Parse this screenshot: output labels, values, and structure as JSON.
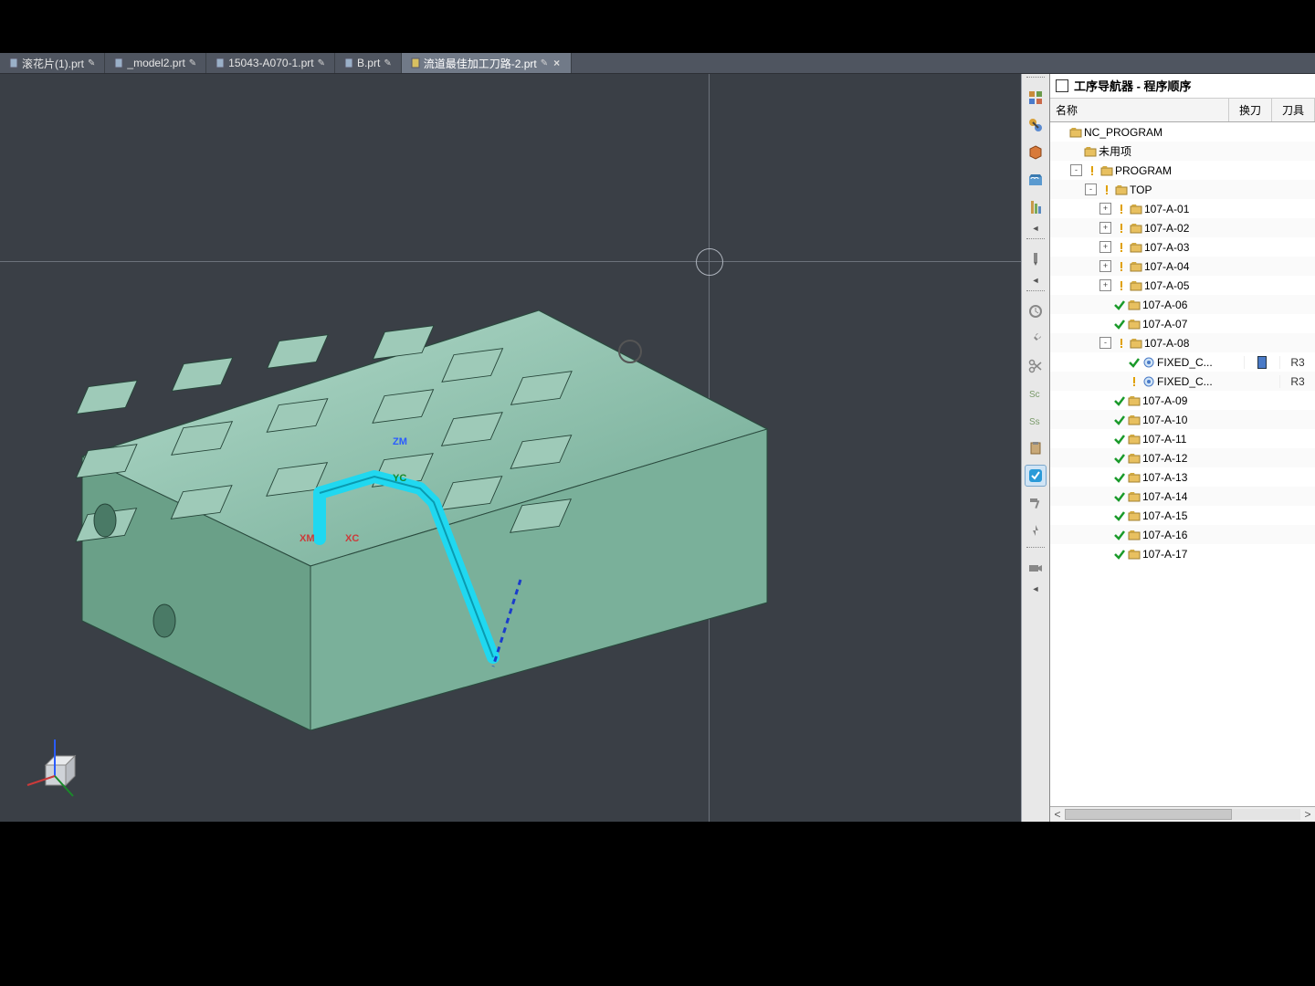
{
  "tabs": [
    {
      "label": "滚花片(1).prt",
      "mod": "✎"
    },
    {
      "label": "_model2.prt",
      "mod": "✎"
    },
    {
      "label": "15043-A070-1.prt",
      "mod": "✎"
    },
    {
      "label": "B.prt",
      "mod": "✎"
    },
    {
      "label": "流道最佳加工刀路-2.prt",
      "mod": "✎",
      "active": true,
      "close": true
    }
  ],
  "panel": {
    "title": "工序导航器 - 程序顺序",
    "columns": {
      "name": "名称",
      "change": "换刀",
      "tool": "刀具"
    },
    "root": "NC_PROGRAM",
    "unused": "未用项",
    "prog": "PROGRAM",
    "top": "TOP",
    "ops": [
      {
        "n": "107-A-01",
        "exp": "+",
        "st": "warn"
      },
      {
        "n": "107-A-02",
        "exp": "+",
        "st": "warn"
      },
      {
        "n": "107-A-03",
        "exp": "+",
        "st": "warn"
      },
      {
        "n": "107-A-04",
        "exp": "+",
        "st": "warn"
      },
      {
        "n": "107-A-05",
        "exp": "+",
        "st": "warn"
      },
      {
        "n": "107-A-06",
        "st": "ok"
      },
      {
        "n": "107-A-07",
        "st": "ok"
      },
      {
        "n": "107-A-08",
        "exp": "-",
        "st": "warn",
        "children": [
          {
            "n": "FIXED_C...",
            "st": "ok",
            "chip": true,
            "tool": "R3",
            "op": true
          },
          {
            "n": "FIXED_C...",
            "st": "warn",
            "tool": "R3",
            "op": true
          }
        ]
      },
      {
        "n": "107-A-09",
        "st": "ok"
      },
      {
        "n": "107-A-10",
        "st": "ok"
      },
      {
        "n": "107-A-11",
        "st": "ok"
      },
      {
        "n": "107-A-12",
        "st": "ok"
      },
      {
        "n": "107-A-13",
        "st": "ok"
      },
      {
        "n": "107-A-14",
        "st": "ok"
      },
      {
        "n": "107-A-15",
        "st": "ok"
      },
      {
        "n": "107-A-16",
        "st": "ok"
      },
      {
        "n": "107-A-17",
        "st": "ok"
      }
    ]
  },
  "axes": {
    "zm": "ZM",
    "yc": "YC",
    "xm": "XM",
    "xc": "XC"
  }
}
